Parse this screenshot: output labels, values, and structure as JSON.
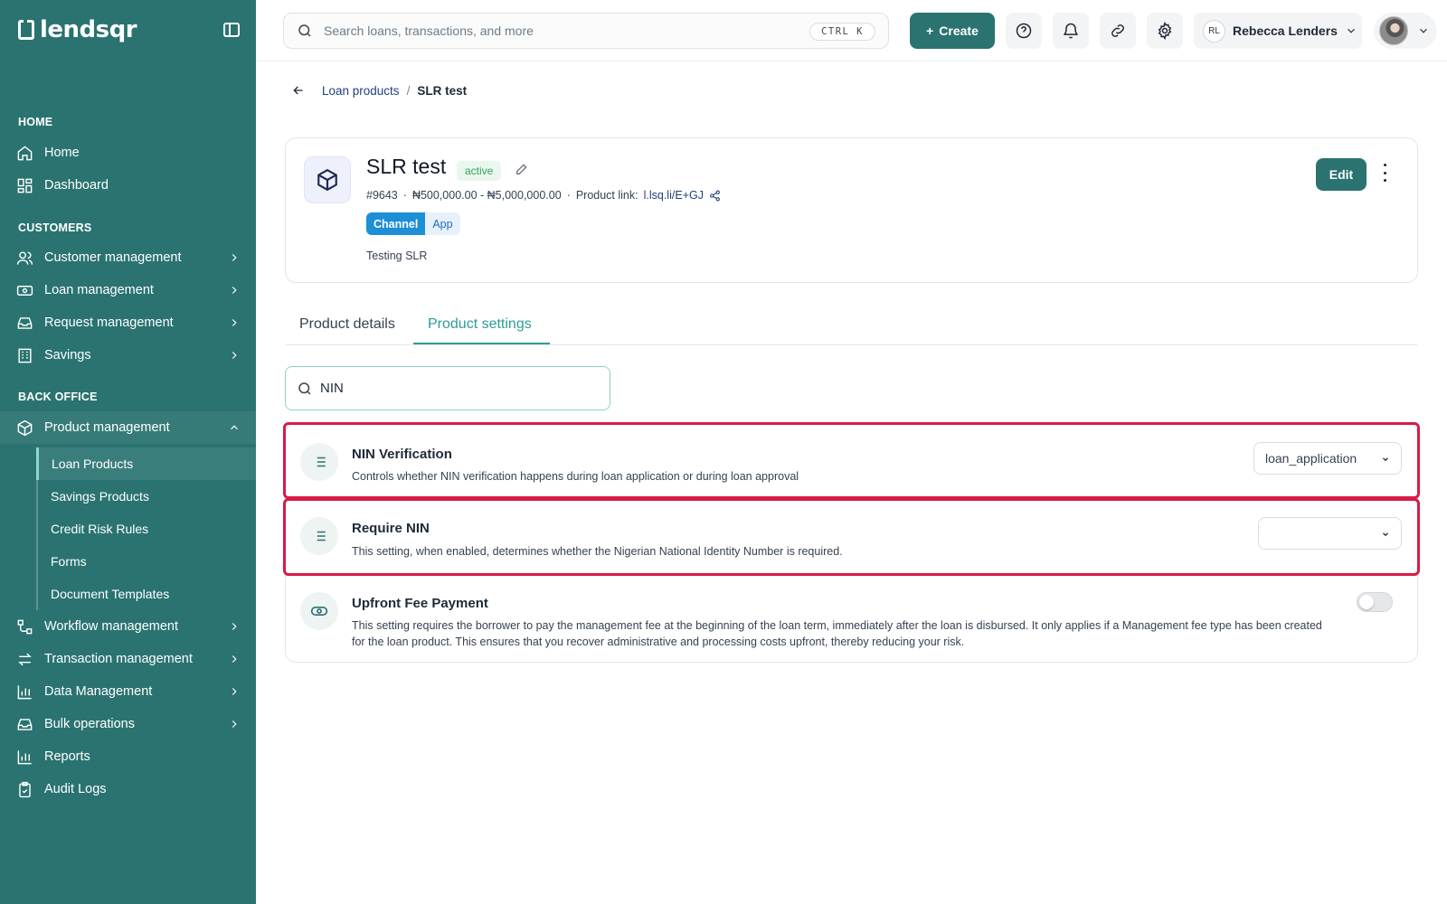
{
  "brand": {
    "name": "lendsqr"
  },
  "sidebar": {
    "sections": {
      "home": "HOME",
      "customers": "CUSTOMERS",
      "back_office": "BACK OFFICE"
    },
    "items": {
      "home": "Home",
      "dashboard": "Dashboard",
      "customer_management": "Customer management",
      "loan_management": "Loan management",
      "request_management": "Request management",
      "savings": "Savings",
      "product_management": "Product management",
      "workflow_management": "Workflow management",
      "transaction_management": "Transaction management",
      "data_management": "Data Management",
      "bulk_operations": "Bulk operations",
      "reports": "Reports",
      "audit_logs": "Audit Logs"
    },
    "sub_items": {
      "loan_products": "Loan Products",
      "savings_products": "Savings Products",
      "credit_risk_rules": "Credit Risk Rules",
      "forms": "Forms",
      "document_templates": "Document Templates"
    }
  },
  "topbar": {
    "search_placeholder": "Search loans, transactions, and more",
    "shortcut": "CTRL K",
    "create_label": "Create",
    "user_initials": "RL",
    "user_name": "Rebecca Lenders"
  },
  "breadcrumb": {
    "parent": "Loan products",
    "separator": "/",
    "current": "SLR test"
  },
  "product": {
    "title": "SLR test",
    "status": "active",
    "id": "#9643",
    "range": "₦500,000.00 - ₦5,000,000.00",
    "link_label": "Product link:",
    "link": "l.lsq.li/E+GJ",
    "channel_key": "Channel",
    "channel_value": "App",
    "description": "Testing SLR",
    "edit_label": "Edit"
  },
  "tabs": {
    "details": "Product details",
    "settings": "Product settings"
  },
  "settings_search": {
    "value": "NIN"
  },
  "settings": [
    {
      "title": "NIN Verification",
      "description": "Controls whether NIN verification happens during loan application or during loan approval",
      "value": "loan_application"
    },
    {
      "title": "Require NIN",
      "description": "This setting, when enabled, determines whether the Nigerian National Identity Number is required.",
      "value": ""
    },
    {
      "title": "Upfront Fee Payment",
      "description": "This setting requires the borrower to pay the management fee at the beginning of the loan term, immediately after the loan is disbursed. It only applies if a Management fee type has been created for the loan product. This ensures that you recover administrative and processing costs upfront, thereby reducing your risk.",
      "enabled": false
    }
  ],
  "colors": {
    "sidebar": "#2a7370",
    "accent": "#2e9c95",
    "highlight": "#d81b45"
  }
}
